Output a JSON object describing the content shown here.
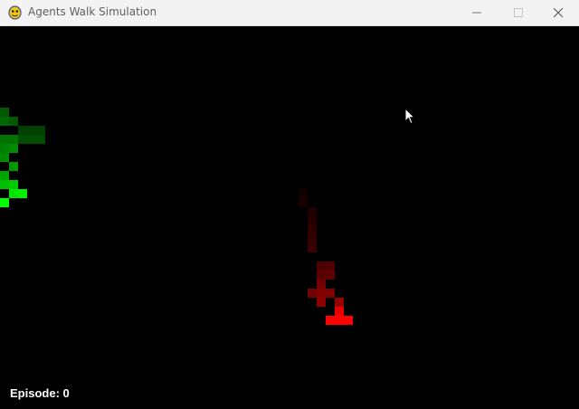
{
  "window": {
    "title": "Agents Walk Simulation",
    "icon": "pygame-snake-icon",
    "controls": [
      "minimize-icon",
      "maximize-icon",
      "close-icon"
    ]
  },
  "hud": {
    "episode_text": "Episode: 0"
  },
  "agents": [
    {
      "name": "green-agent",
      "color": "#00ff00",
      "trail_color": "#00ff00"
    },
    {
      "name": "red-agent",
      "color": "#ff0000",
      "trail_color": "#ff0000"
    }
  ],
  "colors": {
    "background": "#000000",
    "titlebar": "#f3f3f3",
    "hud_text": "#ffffff"
  }
}
